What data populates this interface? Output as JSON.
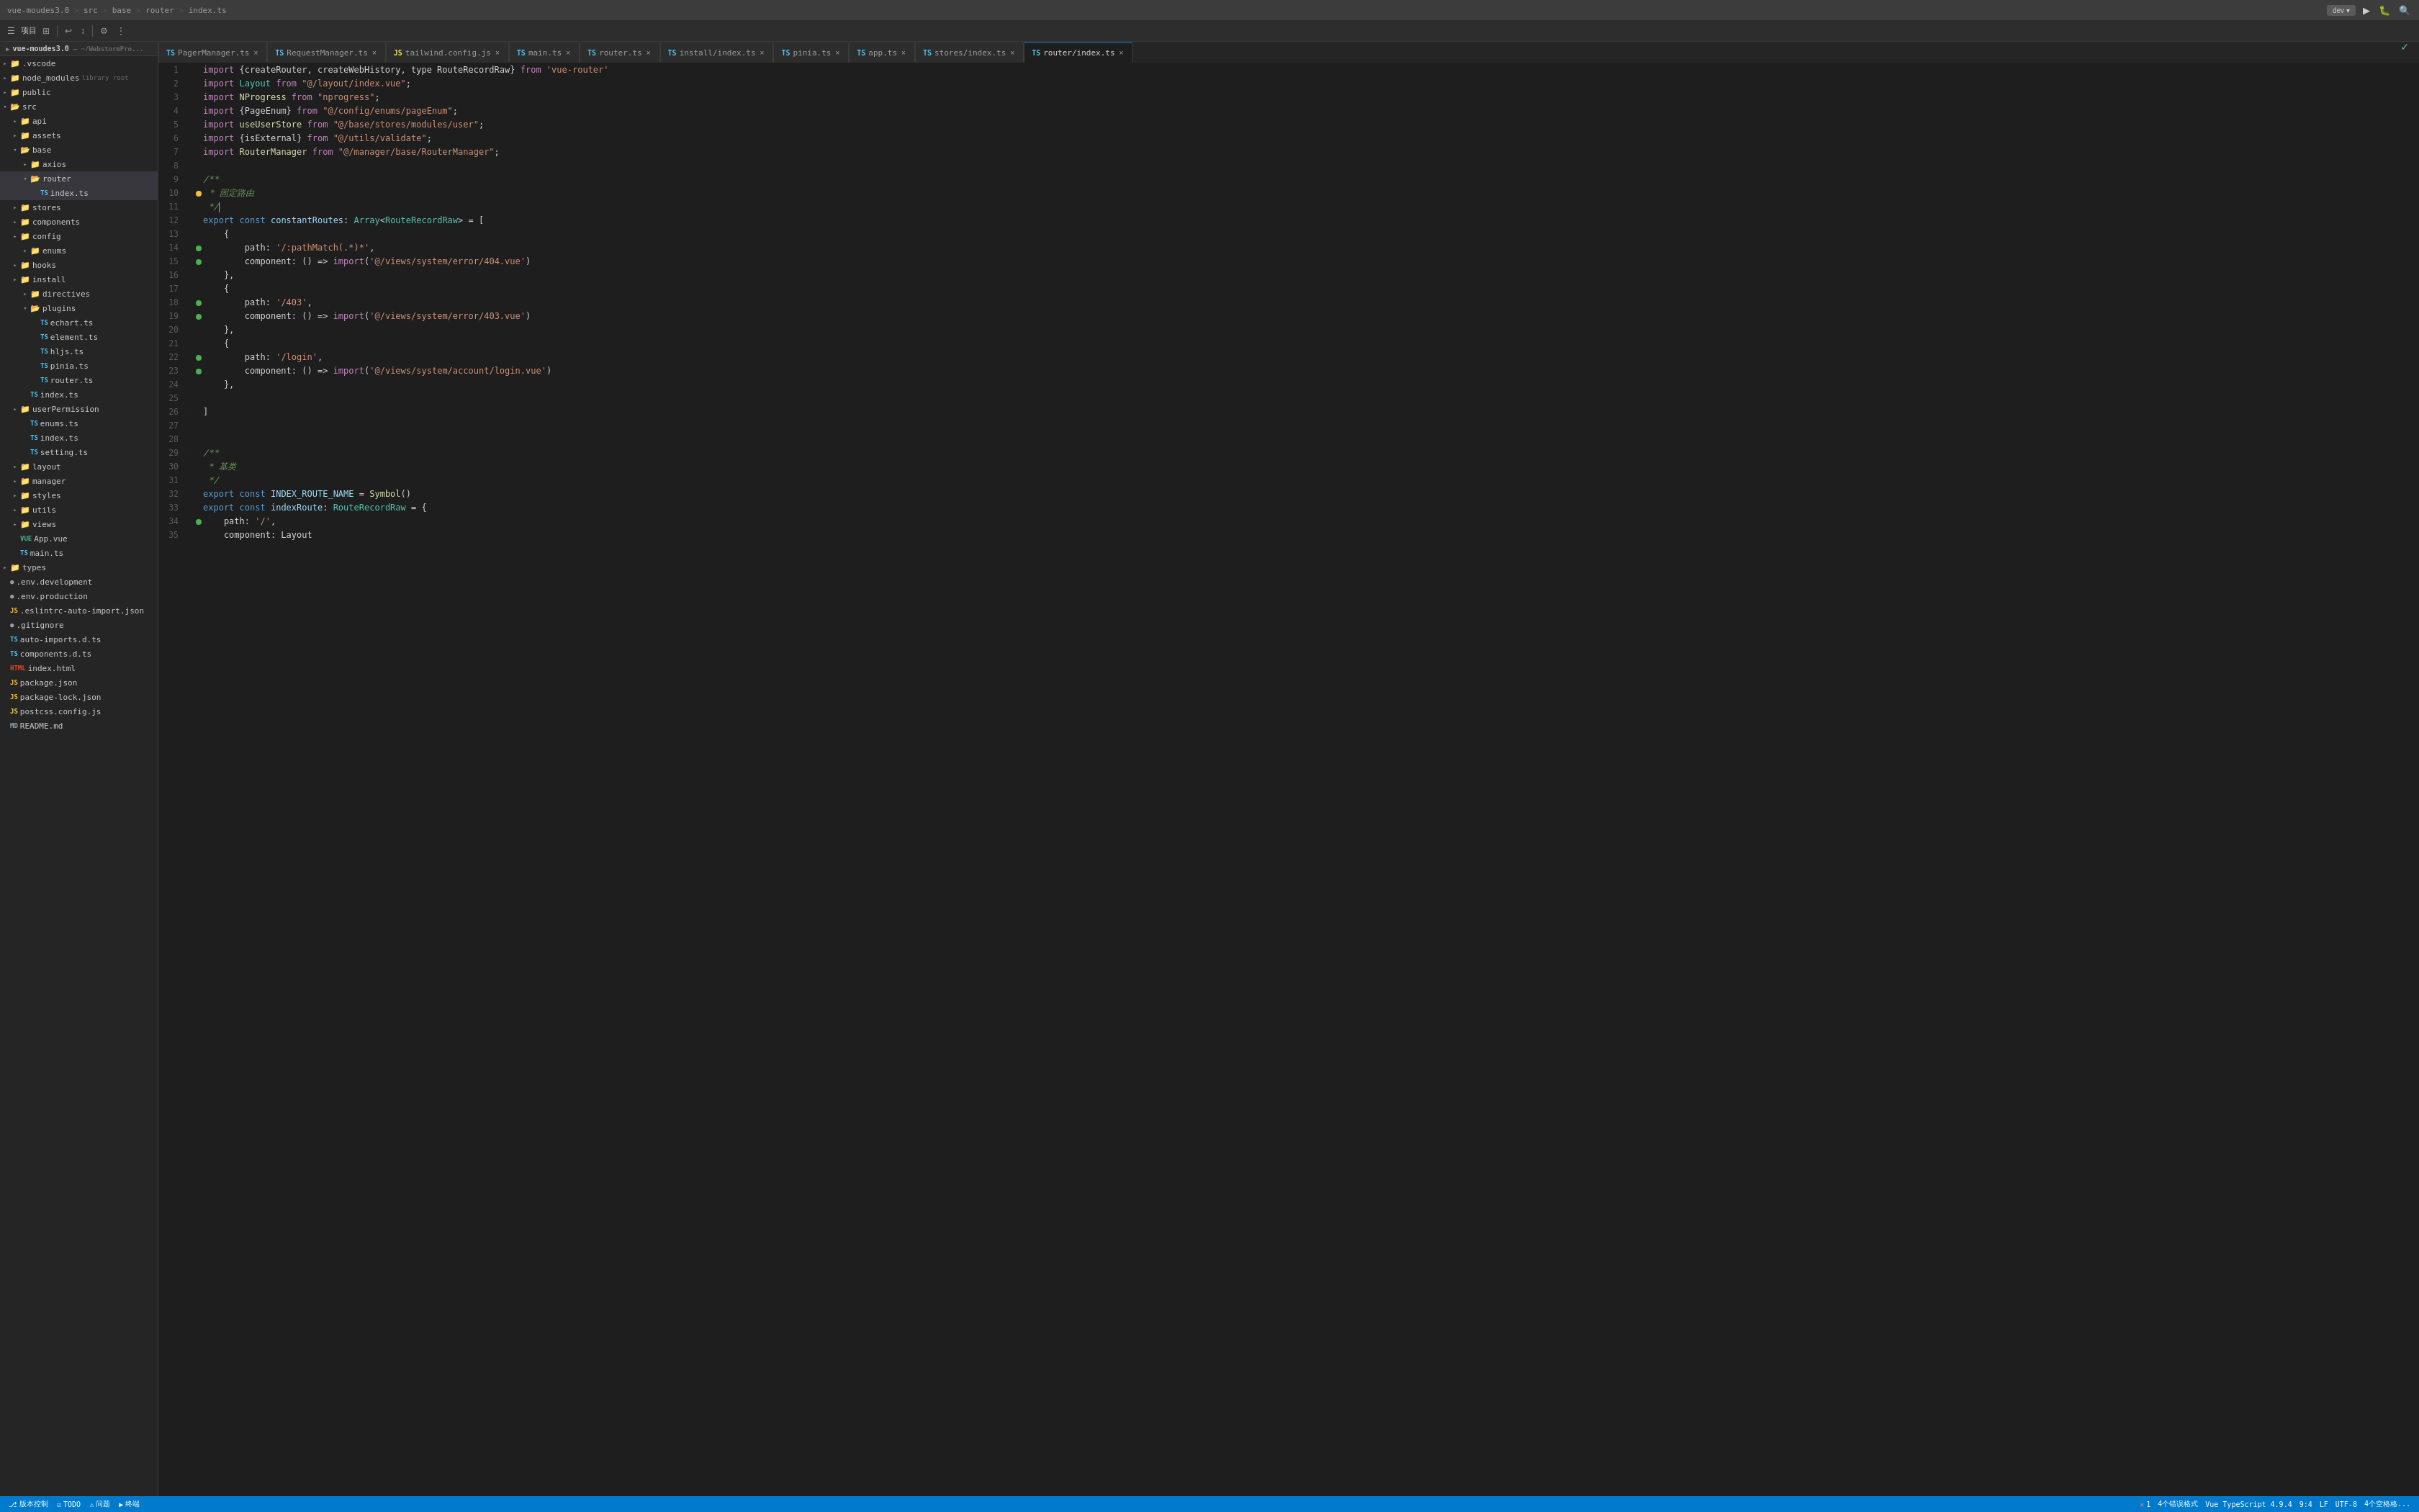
{
  "titleBar": {
    "breadcrumbs": [
      "vue-moudes3.0",
      "src",
      "base",
      "router",
      "index.ts"
    ],
    "devBtn": "dev",
    "runIcon": "▶",
    "searchIcon": "🔍"
  },
  "toolbar": {
    "projectLabel": "项目",
    "buttons": [
      "≡",
      "↩",
      "↕",
      "⚙",
      "⋮"
    ]
  },
  "tabs": [
    {
      "label": "PagerManager.ts",
      "icon": "ts",
      "active": false
    },
    {
      "label": "RequestManager.ts",
      "icon": "ts",
      "active": false
    },
    {
      "label": "tailwind.config.js",
      "icon": "js",
      "active": false
    },
    {
      "label": "main.ts",
      "icon": "ts",
      "active": false
    },
    {
      "label": "router.ts",
      "icon": "ts",
      "active": false
    },
    {
      "label": "install/index.ts",
      "icon": "ts",
      "active": false
    },
    {
      "label": "pinia.ts",
      "icon": "ts",
      "active": false
    },
    {
      "label": "app.ts",
      "icon": "ts",
      "active": false
    },
    {
      "label": "stores/index.ts",
      "icon": "ts",
      "active": false
    },
    {
      "label": "router/index.ts",
      "icon": "ts",
      "active": true
    }
  ],
  "sidebar": {
    "projectName": "vue-moudes3.0",
    "projectPath": "~/WebstormPro...",
    "tree": [
      {
        "id": "vscode",
        "label": ".vscode",
        "level": 1,
        "type": "folder",
        "open": false
      },
      {
        "id": "node_modules",
        "label": "node_modules",
        "level": 1,
        "type": "folder",
        "open": false,
        "tag": "library root"
      },
      {
        "id": "public",
        "label": "public",
        "level": 1,
        "type": "folder",
        "open": false
      },
      {
        "id": "src",
        "label": "src",
        "level": 1,
        "type": "folder",
        "open": true
      },
      {
        "id": "api",
        "label": "api",
        "level": 2,
        "type": "folder",
        "open": false
      },
      {
        "id": "assets",
        "label": "assets",
        "level": 2,
        "type": "folder",
        "open": false
      },
      {
        "id": "base",
        "label": "base",
        "level": 2,
        "type": "folder",
        "open": true
      },
      {
        "id": "axios",
        "label": "axios",
        "level": 3,
        "type": "folder",
        "open": false
      },
      {
        "id": "router",
        "label": "router",
        "level": 3,
        "type": "folder",
        "open": true,
        "selected": true
      },
      {
        "id": "router_index",
        "label": "index.ts",
        "level": 4,
        "type": "ts",
        "active": true
      },
      {
        "id": "stores",
        "label": "stores",
        "level": 2,
        "type": "folder",
        "open": false
      },
      {
        "id": "components",
        "label": "components",
        "level": 2,
        "type": "folder",
        "open": false
      },
      {
        "id": "config",
        "label": "config",
        "level": 2,
        "type": "folder",
        "open": false
      },
      {
        "id": "enums",
        "label": "enums",
        "level": 3,
        "type": "folder",
        "open": false
      },
      {
        "id": "hooks",
        "label": "hooks",
        "level": 2,
        "type": "folder",
        "open": false
      },
      {
        "id": "install",
        "label": "install",
        "level": 2,
        "type": "folder",
        "open": false
      },
      {
        "id": "directives",
        "label": "directives",
        "level": 3,
        "type": "folder",
        "open": false
      },
      {
        "id": "plugins",
        "label": "plugins",
        "level": 3,
        "type": "folder",
        "open": true
      },
      {
        "id": "echart_ts",
        "label": "echart.ts",
        "level": 4,
        "type": "ts"
      },
      {
        "id": "element_ts",
        "label": "element.ts",
        "level": 4,
        "type": "ts"
      },
      {
        "id": "hljs_ts",
        "label": "hljs.ts",
        "level": 4,
        "type": "ts"
      },
      {
        "id": "pinia_ts",
        "label": "pinia.ts",
        "level": 4,
        "type": "ts"
      },
      {
        "id": "router_ts",
        "label": "router.ts",
        "level": 4,
        "type": "ts"
      },
      {
        "id": "install_index",
        "label": "index.ts",
        "level": 3,
        "type": "ts"
      },
      {
        "id": "userPermission",
        "label": "userPermission",
        "level": 2,
        "type": "folder",
        "open": false
      },
      {
        "id": "enums_ts",
        "label": "enums.ts",
        "level": 3,
        "type": "ts"
      },
      {
        "id": "up_index",
        "label": "index.ts",
        "level": 3,
        "type": "ts"
      },
      {
        "id": "setting_ts",
        "label": "setting.ts",
        "level": 3,
        "type": "ts"
      },
      {
        "id": "layout",
        "label": "layout",
        "level": 2,
        "type": "folder",
        "open": false
      },
      {
        "id": "manager",
        "label": "manager",
        "level": 2,
        "type": "folder",
        "open": false
      },
      {
        "id": "styles",
        "label": "styles",
        "level": 2,
        "type": "folder",
        "open": false
      },
      {
        "id": "utils",
        "label": "utils",
        "level": 2,
        "type": "folder",
        "open": false
      },
      {
        "id": "views",
        "label": "views",
        "level": 2,
        "type": "folder",
        "open": false
      },
      {
        "id": "app_vue",
        "label": "App.vue",
        "level": 2,
        "type": "vue"
      },
      {
        "id": "main_ts",
        "label": "main.ts",
        "level": 2,
        "type": "ts"
      },
      {
        "id": "types",
        "label": "types",
        "level": 1,
        "type": "folder",
        "open": false
      },
      {
        "id": "env_dev",
        "label": ".env.development",
        "level": 1,
        "type": "dotfile"
      },
      {
        "id": "env_prod",
        "label": ".env.production",
        "level": 1,
        "type": "dotfile"
      },
      {
        "id": "eslintrc",
        "label": ".eslintrc-auto-import.json",
        "level": 1,
        "type": "json"
      },
      {
        "id": "gitignore",
        "label": ".gitignore",
        "level": 1,
        "type": "dotfile"
      },
      {
        "id": "auto_imports",
        "label": "auto-imports.d.ts",
        "level": 1,
        "type": "ts"
      },
      {
        "id": "components_d",
        "label": "components.d.ts",
        "level": 1,
        "type": "ts"
      },
      {
        "id": "index_html",
        "label": "index.html",
        "level": 1,
        "type": "html"
      },
      {
        "id": "package_json",
        "label": "package.json",
        "level": 1,
        "type": "json"
      },
      {
        "id": "package_lock",
        "label": "package-lock.json",
        "level": 1,
        "type": "json"
      },
      {
        "id": "postcss_js",
        "label": "postcss.config.js",
        "level": 1,
        "type": "js"
      },
      {
        "id": "readme",
        "label": "README.md",
        "level": 1,
        "type": "md"
      }
    ]
  },
  "codeLines": [
    {
      "num": 1,
      "tokens": [
        {
          "t": "import ",
          "c": "kw"
        },
        {
          "t": "{createRouter, createWebHistory, type RouteRecordRaw}",
          "c": ""
        },
        {
          "t": " from ",
          "c": "kw"
        },
        {
          "t": "'vue-router'",
          "c": "str"
        }
      ]
    },
    {
      "num": 2,
      "tokens": [
        {
          "t": "import ",
          "c": "kw"
        },
        {
          "t": "Layout",
          "c": "type"
        },
        {
          "t": " from ",
          "c": "kw"
        },
        {
          "t": "\"@/layout/index.vue\"",
          "c": "str"
        },
        {
          "t": ";",
          "c": ""
        }
      ]
    },
    {
      "num": 3,
      "tokens": [
        {
          "t": "import ",
          "c": "kw"
        },
        {
          "t": "NProgress",
          "c": "fn"
        },
        {
          "t": " from ",
          "c": "kw"
        },
        {
          "t": "\"nprogress\"",
          "c": "str"
        },
        {
          "t": ";",
          "c": ""
        }
      ]
    },
    {
      "num": 4,
      "tokens": [
        {
          "t": "import ",
          "c": "kw"
        },
        {
          "t": "{PageEnum}",
          "c": ""
        },
        {
          "t": " from ",
          "c": "kw"
        },
        {
          "t": "\"@/config/enums/pageEnum\"",
          "c": "str"
        },
        {
          "t": ";",
          "c": ""
        }
      ]
    },
    {
      "num": 5,
      "tokens": [
        {
          "t": "import ",
          "c": "kw"
        },
        {
          "t": "useUserStore",
          "c": "fn"
        },
        {
          "t": " from ",
          "c": "kw"
        },
        {
          "t": "\"@/base/stores/modules/user\"",
          "c": "str"
        },
        {
          "t": ";",
          "c": ""
        }
      ]
    },
    {
      "num": 6,
      "tokens": [
        {
          "t": "import ",
          "c": "kw"
        },
        {
          "t": "{isExternal}",
          "c": ""
        },
        {
          "t": " from ",
          "c": "kw"
        },
        {
          "t": "\"@/utils/validate\"",
          "c": "str"
        },
        {
          "t": ";",
          "c": ""
        }
      ]
    },
    {
      "num": 7,
      "tokens": [
        {
          "t": "import ",
          "c": "kw"
        },
        {
          "t": "RouterManager",
          "c": "fn"
        },
        {
          "t": " from ",
          "c": "kw"
        },
        {
          "t": "\"@/manager/base/RouterManager\"",
          "c": "str"
        },
        {
          "t": ";",
          "c": ""
        }
      ]
    },
    {
      "num": 8,
      "tokens": []
    },
    {
      "num": 9,
      "tokens": [
        {
          "t": "/**",
          "c": "comment"
        }
      ],
      "fold": true
    },
    {
      "num": 10,
      "tokens": [
        {
          "t": " * ",
          "c": "comment"
        },
        {
          "t": "固定路由",
          "c": "comment"
        }
      ],
      "dot": "yellow"
    },
    {
      "num": 11,
      "tokens": [
        {
          "t": " */",
          "c": "comment"
        }
      ],
      "fold": true,
      "cursor": true
    },
    {
      "num": 12,
      "tokens": [
        {
          "t": "export ",
          "c": "kw2"
        },
        {
          "t": "const ",
          "c": "kw2"
        },
        {
          "t": "constantRoutes",
          "c": "var-name"
        },
        {
          "t": ": ",
          "c": ""
        },
        {
          "t": "Array",
          "c": "array-type"
        },
        {
          "t": "<",
          "c": ""
        },
        {
          "t": "RouteRecordRaw",
          "c": "type"
        },
        {
          "t": "> = [",
          "c": ""
        }
      ],
      "fold": true
    },
    {
      "num": 13,
      "tokens": [
        {
          "t": "    {",
          "c": ""
        }
      ]
    },
    {
      "num": 14,
      "tokens": [
        {
          "t": "        path: ",
          "c": ""
        },
        {
          "t": "'/:pathMatch(.*)*'",
          "c": "str"
        },
        {
          "t": ",",
          "c": ""
        }
      ],
      "dot": "green"
    },
    {
      "num": 15,
      "tokens": [
        {
          "t": "        component: ",
          "c": ""
        },
        {
          "t": "() => ",
          "c": ""
        },
        {
          "t": "import",
          "c": "kw"
        },
        {
          "t": "(",
          "c": ""
        },
        {
          "t": "'@/views/system/error/404.vue'",
          "c": "str"
        },
        {
          "t": ")",
          "c": ""
        }
      ],
      "dot": "green"
    },
    {
      "num": 16,
      "tokens": [
        {
          "t": "    },",
          "c": ""
        }
      ],
      "fold": true
    },
    {
      "num": 17,
      "tokens": [
        {
          "t": "    {",
          "c": ""
        }
      ]
    },
    {
      "num": 18,
      "tokens": [
        {
          "t": "        path: ",
          "c": ""
        },
        {
          "t": "'/403'",
          "c": "str"
        },
        {
          "t": ",",
          "c": ""
        }
      ],
      "dot": "green"
    },
    {
      "num": 19,
      "tokens": [
        {
          "t": "        component: ",
          "c": ""
        },
        {
          "t": "() => ",
          "c": ""
        },
        {
          "t": "import",
          "c": "kw"
        },
        {
          "t": "(",
          "c": ""
        },
        {
          "t": "'@/views/system/error/403.vue'",
          "c": "str"
        },
        {
          "t": ")",
          "c": ""
        }
      ],
      "dot": "green"
    },
    {
      "num": 20,
      "tokens": [
        {
          "t": "    },",
          "c": ""
        }
      ],
      "fold": true
    },
    {
      "num": 21,
      "tokens": [
        {
          "t": "    {",
          "c": ""
        }
      ]
    },
    {
      "num": 22,
      "tokens": [
        {
          "t": "        path: ",
          "c": ""
        },
        {
          "t": "'/login'",
          "c": "str"
        },
        {
          "t": ",",
          "c": ""
        }
      ],
      "dot": "green"
    },
    {
      "num": 23,
      "tokens": [
        {
          "t": "        component: ",
          "c": ""
        },
        {
          "t": "() => ",
          "c": ""
        },
        {
          "t": "import",
          "c": "kw"
        },
        {
          "t": "(",
          "c": ""
        },
        {
          "t": "'@/views/system/account/login.vue'",
          "c": "str"
        },
        {
          "t": ")",
          "c": ""
        }
      ],
      "dot": "green"
    },
    {
      "num": 24,
      "tokens": [
        {
          "t": "    },",
          "c": ""
        }
      ]
    },
    {
      "num": 25,
      "tokens": []
    },
    {
      "num": 26,
      "tokens": [
        {
          "t": "]",
          "c": ""
        }
      ],
      "fold": true
    },
    {
      "num": 27,
      "tokens": []
    },
    {
      "num": 28,
      "tokens": []
    },
    {
      "num": 29,
      "tokens": [
        {
          "t": "/**",
          "c": "comment"
        }
      ],
      "fold": true
    },
    {
      "num": 30,
      "tokens": [
        {
          "t": " * ",
          "c": "comment"
        },
        {
          "t": "基类",
          "c": "comment"
        }
      ]
    },
    {
      "num": 31,
      "tokens": [
        {
          "t": " */",
          "c": "comment"
        }
      ],
      "fold": true
    },
    {
      "num": 32,
      "tokens": [
        {
          "t": "export ",
          "c": "kw2"
        },
        {
          "t": "const ",
          "c": "kw2"
        },
        {
          "t": "INDEX_ROUTE_NAME",
          "c": "var-name"
        },
        {
          "t": " = ",
          "c": ""
        },
        {
          "t": "Symbol",
          "c": "fn"
        },
        {
          "t": "()",
          "c": ""
        }
      ]
    },
    {
      "num": 33,
      "tokens": [
        {
          "t": "export ",
          "c": "kw2"
        },
        {
          "t": "const ",
          "c": "kw2"
        },
        {
          "t": "indexRoute",
          "c": "var-name"
        },
        {
          "t": ": ",
          "c": ""
        },
        {
          "t": "RouteRecordRaw",
          "c": "type"
        },
        {
          "t": " = {",
          "c": ""
        }
      ],
      "fold": true
    },
    {
      "num": 34,
      "tokens": [
        {
          "t": "    path: ",
          "c": ""
        },
        {
          "t": "'/'",
          "c": "str"
        },
        {
          "t": ",",
          "c": ""
        }
      ],
      "dot": "green"
    },
    {
      "num": 35,
      "tokens": [
        {
          "t": "    component: Layout",
          "c": ""
        }
      ]
    }
  ],
  "statusBar": {
    "branchIcon": "⎇",
    "branch": "版本控制",
    "todoLabel": "TODO",
    "problemLabel": "问题",
    "terminalLabel": "终端",
    "errors": "1",
    "warnings": "4个错误格式",
    "fileType": "Vue TypeScript 4.9.4",
    "lineCol": "9:4",
    "lineEnding": "LF",
    "encoding": "UTF-8",
    "indentInfo": "4个空格格..."
  }
}
